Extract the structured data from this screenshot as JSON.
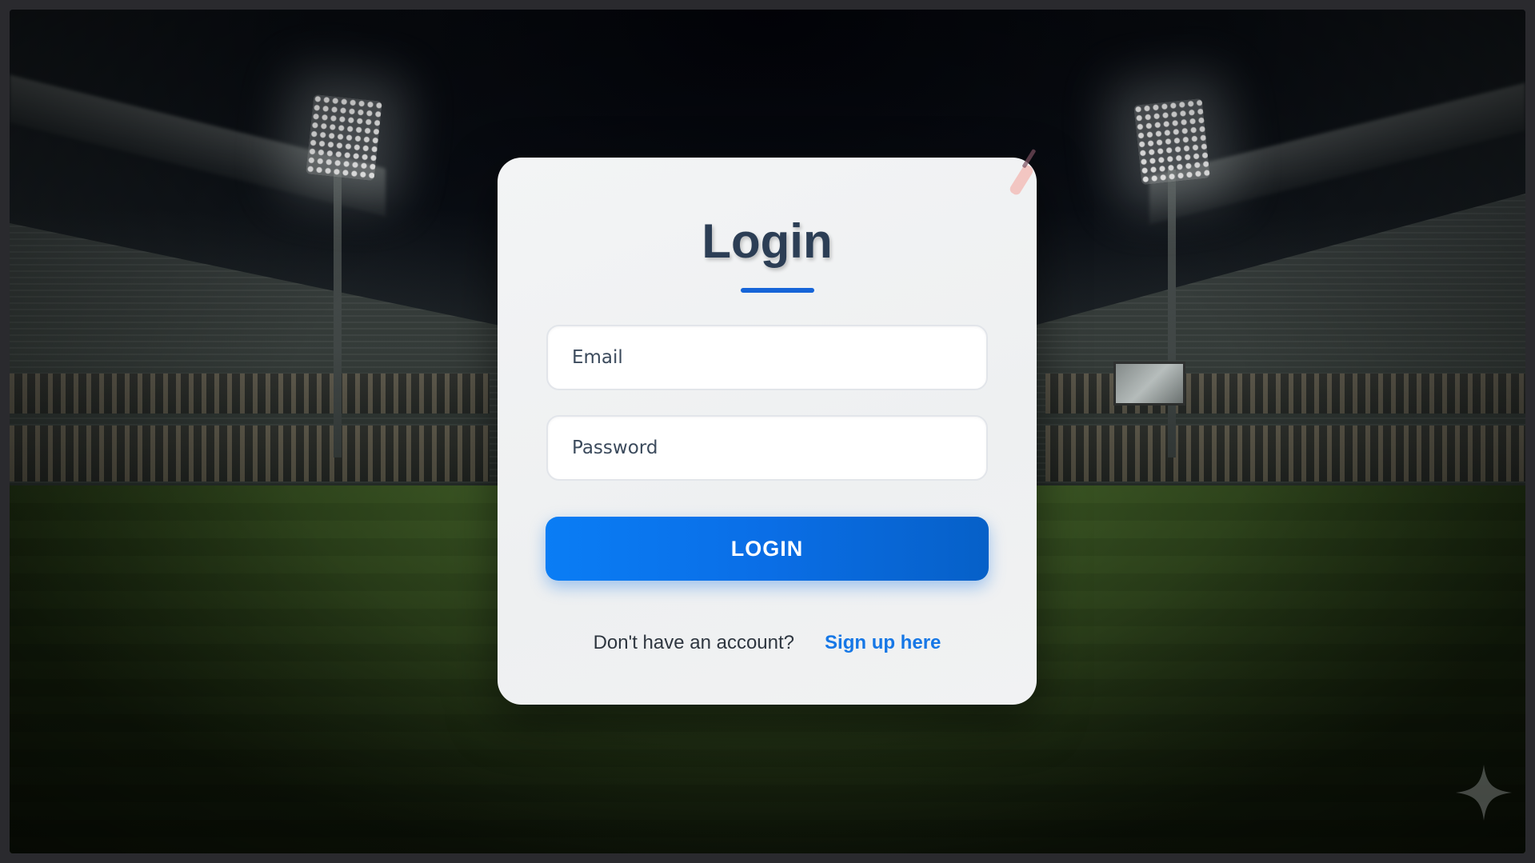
{
  "login": {
    "title": "Login",
    "email_placeholder": "Email",
    "password_placeholder": "Password",
    "button_label": "LOGIN",
    "signup_prompt": "Don't have an account?",
    "signup_link": "Sign up here"
  },
  "icons": {
    "card_corner": "cricket-bat-icon",
    "watermark": "sparkle-icon"
  },
  "colors": {
    "accent": "#0a6ee6",
    "title": "#2c3e55",
    "link": "#1677e6"
  }
}
